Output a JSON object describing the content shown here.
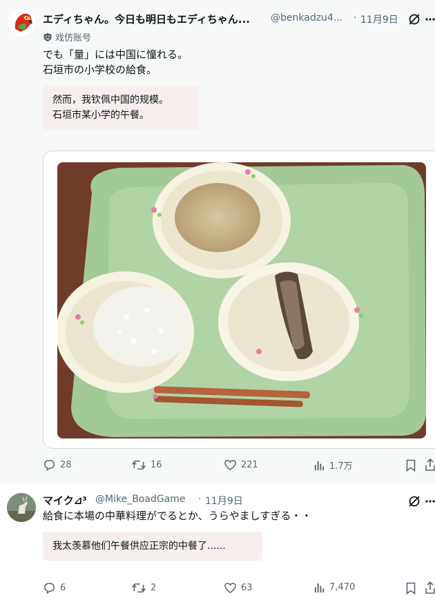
{
  "tweet1": {
    "author_name": "エディちゃん。今日も明日もエディちゃん...",
    "handle": "@benkadzu4...",
    "separator": "·",
    "date": "11月9日",
    "badge_icon": "shield-icon",
    "badge_text": "戏仿账号",
    "text": "でも「量」には中国に憧れる。\n石垣市の小学校の給食。",
    "translation": "然而，我钦佩中国的规模。\n石垣市某小学的午餐。",
    "actions": {
      "replies": "28",
      "retweets": "16",
      "likes": "221",
      "views": "1.7万"
    }
  },
  "tweet2": {
    "author_name": "マイク⊿³",
    "handle": "@Mike_BoadGame",
    "separator": "·",
    "date": "11月9日",
    "text": "給食に本場の中華料理がでるとか、うらやましすぎる・・",
    "translation": "我太羡慕他们午餐供应正宗的中餐了......",
    "actions": {
      "replies": "6",
      "retweets": "2",
      "likes": "63",
      "views": "7,470"
    }
  },
  "colors": {
    "feed_bg": "#f7f9f9",
    "secondary_text": "#536471",
    "translation_bg": "#f7efed",
    "tray_green": "#a9cfa0"
  }
}
